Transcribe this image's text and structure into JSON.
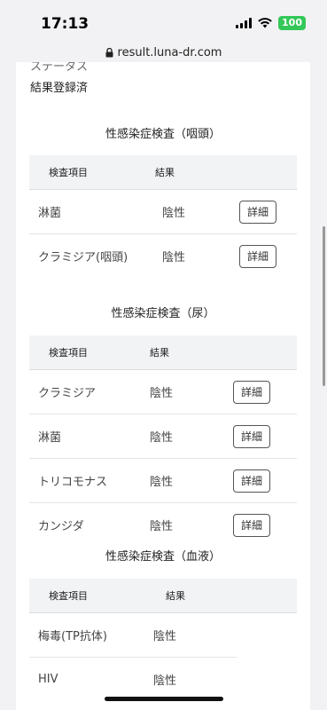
{
  "device": {
    "time": "17:13",
    "battery": "100"
  },
  "browser": {
    "url": "result.luna-dr.com"
  },
  "result": {
    "status_label": "ステータス",
    "status_value": "結果登録済"
  },
  "sections": [
    {
      "title": "性感染症検査（咽頭）",
      "header_item": "検査項目",
      "header_result": "結果",
      "rows": [
        {
          "item": "淋菌",
          "result": "陰性",
          "button": "詳細"
        },
        {
          "item": "クラミジア(咽頭)",
          "result": "陰性",
          "button": "詳細"
        }
      ]
    },
    {
      "title": "性感染症検査（尿）",
      "header_item": "検査項目",
      "header_result": "結果",
      "rows": [
        {
          "item": "クラミジア",
          "result": "陰性",
          "button": "詳細"
        },
        {
          "item": "淋菌",
          "result": "陰性",
          "button": "詳細"
        },
        {
          "item": "トリコモナス",
          "result": "陰性",
          "button": "詳細"
        },
        {
          "item": "カンジダ",
          "result": "陰性",
          "button": "詳細"
        }
      ]
    },
    {
      "title": "性感染症検査（血液）",
      "header_item": "検査項目",
      "header_result": "結果",
      "rows": [
        {
          "item": "梅毒(TP抗体)",
          "result": "陰性"
        },
        {
          "item": "HIV",
          "result": "陰性"
        }
      ]
    }
  ]
}
